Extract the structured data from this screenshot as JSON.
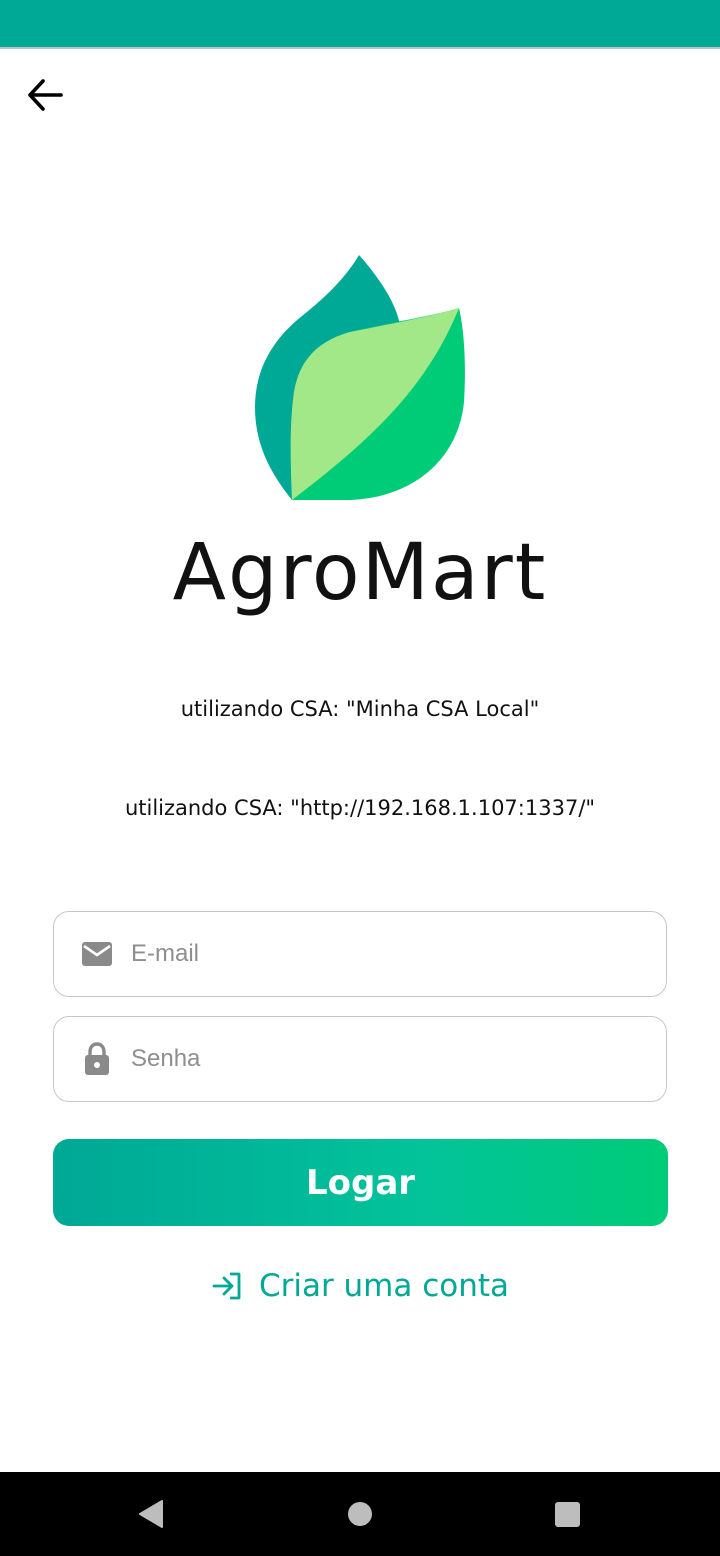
{
  "app": {
    "title": "AgroMart"
  },
  "colors": {
    "status_bar": "#00a896",
    "accent": "#00a896",
    "button_gradient_start": "#00a896",
    "button_gradient_end": "#00cc78",
    "leaf_dark": "#00a896",
    "leaf_light": "#a3e888",
    "leaf_green": "#00cc78"
  },
  "icons": {
    "back": "arrow-left-icon",
    "logo": "leaf-logo-icon",
    "email": "mail-icon",
    "password": "lock-icon",
    "create_account": "login-arrow-icon",
    "nav_back": "triangle-back-icon",
    "nav_home": "circle-home-icon",
    "nav_recents": "square-recents-icon"
  },
  "info": {
    "csa_name_line": "utilizando CSA: \"Minha CSA Local\"",
    "csa_url_line": "utilizando CSA: \"http://192.168.1.107:1337/\""
  },
  "form": {
    "email_placeholder": "E-mail",
    "password_placeholder": "Senha",
    "login_label": "Logar",
    "create_account_label": "Criar uma conta"
  }
}
